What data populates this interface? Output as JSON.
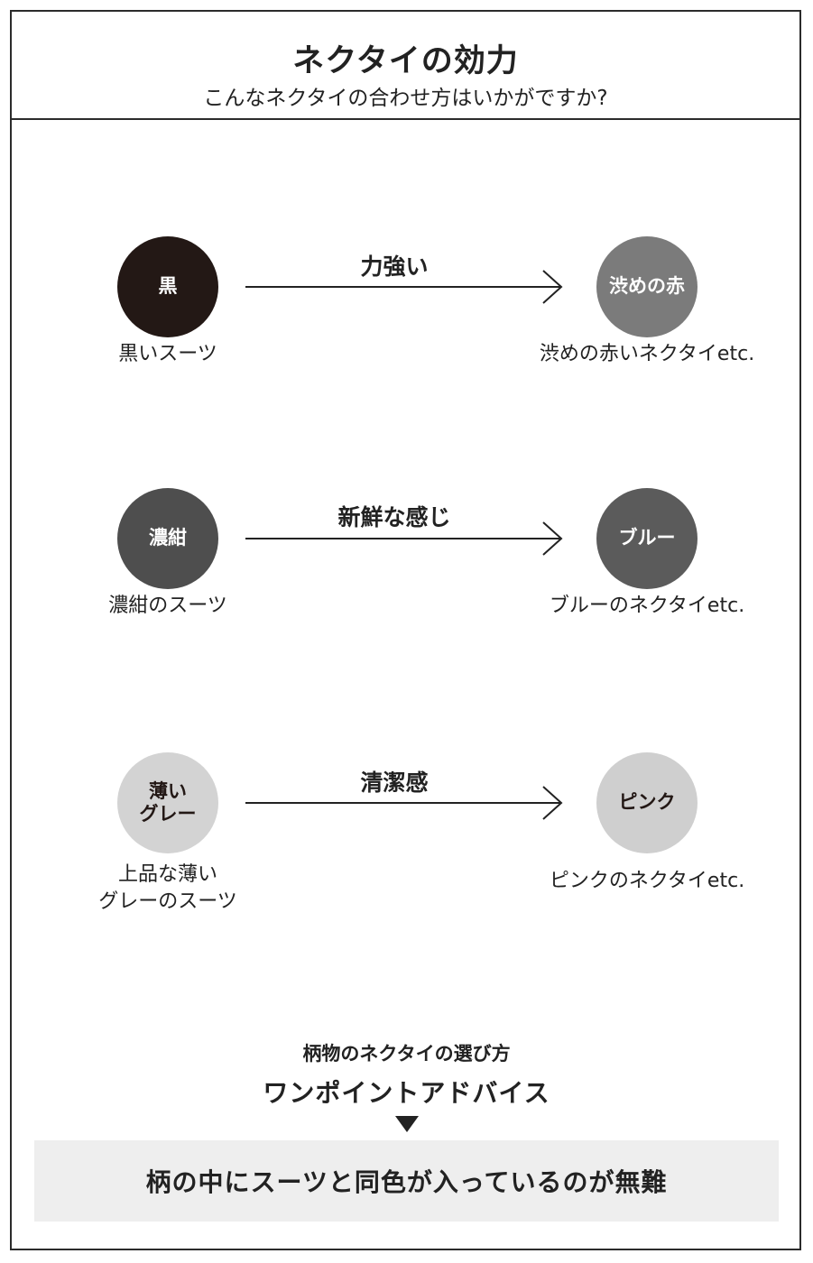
{
  "header": {
    "title": "ネクタイの効力",
    "subtitle": "こんなネクタイの合わせ方はいかがですか?"
  },
  "rows": [
    {
      "suit": {
        "circle_text": "黒",
        "label": "黒いスーツ",
        "color": "#231815",
        "text_color": "#ffffff"
      },
      "effect": "力強い",
      "tie": {
        "circle_text": "渋めの赤",
        "label": "渋めの赤いネクタイetc.",
        "color": "#7b7b7b",
        "text_color": "#ffffff"
      }
    },
    {
      "suit": {
        "circle_text": "濃紺",
        "label": "濃紺のスーツ",
        "color": "#4e4e4e",
        "text_color": "#ffffff"
      },
      "effect": "新鮮な感じ",
      "tie": {
        "circle_text": "ブルー",
        "label": "ブルーのネクタイetc.",
        "color": "#5b5b5b",
        "text_color": "#ffffff"
      }
    },
    {
      "suit": {
        "circle_text": "薄い\nグレー",
        "label": "上品な薄い\nグレーのスーツ",
        "color": "#d3d3d3",
        "text_color": "#231815"
      },
      "effect": "清潔感",
      "tie": {
        "circle_text": "ピンク",
        "label": "ピンクのネクタイetc.",
        "color": "#cfcfcf",
        "text_color": "#231815"
      }
    }
  ],
  "advice": {
    "subtitle": "柄物のネクタイの選び方",
    "title": "ワンポイントアドバイス",
    "body": "柄の中にスーツと同色が入っているのが無難"
  }
}
